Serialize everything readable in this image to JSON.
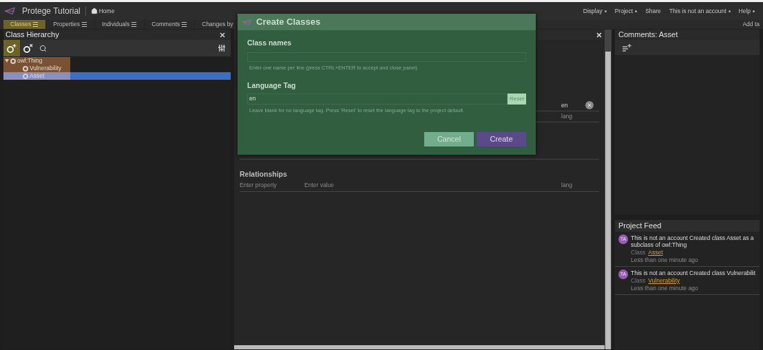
{
  "app": {
    "title": "Protege Tutorial",
    "home": "Home"
  },
  "menu": [
    {
      "label": "Display",
      "dropdown": true
    },
    {
      "label": "Project",
      "dropdown": true
    },
    {
      "label": "Share",
      "dropdown": false
    },
    {
      "label": "This is not an account",
      "dropdown": true
    },
    {
      "label": "Help",
      "dropdown": true
    }
  ],
  "tabs": [
    {
      "label": "Classes",
      "selected": true,
      "menu_icon": "☰"
    },
    {
      "label": "Properties",
      "selected": false,
      "menu_icon": "☰"
    },
    {
      "label": "Individuals",
      "selected": false,
      "menu_icon": "☰"
    },
    {
      "label": "Comments",
      "selected": false,
      "menu_icon": "☰"
    },
    {
      "label": "Changes by",
      "selected": false
    }
  ],
  "add_tab": "Add ta",
  "class_hierarchy": {
    "title": "Class Hierarchy",
    "tree": [
      {
        "label": "owl:Thing",
        "expanded": true,
        "selected": false,
        "children": [
          {
            "label": "Vulnerability",
            "selected": false
          },
          {
            "label": "Asset",
            "selected": true
          }
        ]
      }
    ]
  },
  "editor": {
    "annotation_lang": "en",
    "lang_placeholder": "lang",
    "relationships": {
      "title": "Relationships",
      "property_placeholder": "Enter property",
      "value_placeholder": "Enter value",
      "lang_placeholder": "lang"
    }
  },
  "comments": {
    "title": "Comments: Asset"
  },
  "project_feed": {
    "title": "Project Feed",
    "items": [
      {
        "avatar": "TA",
        "text": "This is not an account Created class Asset as a subclass of owl:Thing",
        "class_label": "Class",
        "class_link": "Asset",
        "time": "Less than one minute ago"
      },
      {
        "avatar": "TA",
        "text": "This is not an account Created class Vulnerabilit",
        "class_label": "Class",
        "class_link": "Vulnerability",
        "time": "Less than one minute ago"
      }
    ]
  },
  "dialog": {
    "title": "Create Classes",
    "class_names_label": "Class names",
    "class_names_hint": "Enter one name per line (press CTRL+ENTER to accept and close panel)",
    "language_tag_label": "Language Tag",
    "language_tag_value": "en",
    "reset": "Reset",
    "language_tag_hint": "Leave blank for no language tag. Press 'Reset' to reset the language tag to the project default.",
    "buttons": [
      {
        "label": "Cancel",
        "kind": "secondary"
      },
      {
        "label": "Create",
        "kind": "primary"
      }
    ]
  }
}
